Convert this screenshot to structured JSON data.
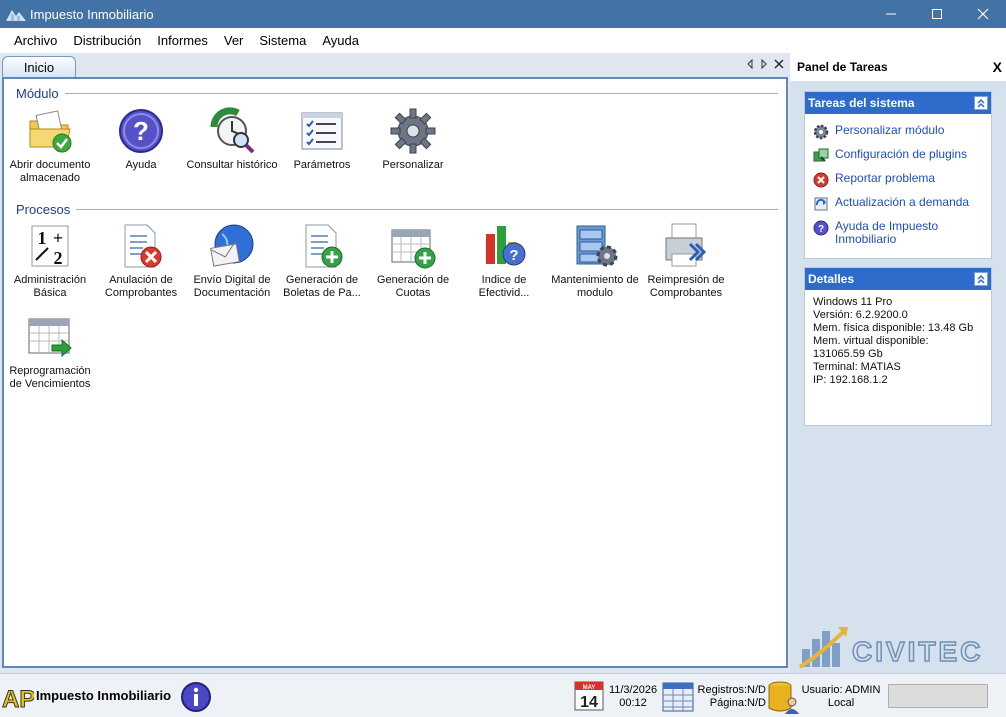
{
  "window": {
    "title": "Impuesto Inmobiliario"
  },
  "menu": [
    "Archivo",
    "Distribución",
    "Informes",
    "Ver",
    "Sistema",
    "Ayuda"
  ],
  "tab": {
    "label": "Inicio"
  },
  "modulo": {
    "header": "Módulo",
    "items": [
      {
        "label": "Abrir documento almacenado",
        "icon": "folder-check-icon"
      },
      {
        "label": "Ayuda",
        "icon": "help-icon"
      },
      {
        "label": "Consultar histórico",
        "icon": "history-clock-icon"
      },
      {
        "label": "Parámetros",
        "icon": "checklist-icon"
      },
      {
        "label": "Personalizar",
        "icon": "gear-icon"
      }
    ]
  },
  "procesos": {
    "header": "Procesos",
    "items": [
      {
        "label": "Administración Básica",
        "icon": "numbers-icon"
      },
      {
        "label": "Anulación de Comprobantes",
        "icon": "document-cancel-icon"
      },
      {
        "label": "Envío Digital de Documentación",
        "icon": "globe-mail-icon"
      },
      {
        "label": "Generación de Boletas de Pa...",
        "icon": "document-add-icon"
      },
      {
        "label": "Generación de Cuotas",
        "icon": "calendar-add-icon"
      },
      {
        "label": "Indice de Efectivid...",
        "icon": "chart-help-icon"
      },
      {
        "label": "Mantenimiento de modulo",
        "icon": "cabinet-gear-icon"
      },
      {
        "label": "Reimpresión de Comprobantes",
        "icon": "printer-icon"
      },
      {
        "label": "Reprogramación de Vencimientos",
        "icon": "calendar-arrow-icon"
      }
    ]
  },
  "taskpanel": {
    "title": "Panel de Tareas",
    "close": "X",
    "tareas": {
      "header": "Tareas del sistema",
      "items": [
        {
          "label": "Personalizar módulo",
          "icon": "gear-icon"
        },
        {
          "label": "Configuración de plugins",
          "icon": "plugin-icon"
        },
        {
          "label": "Reportar problema",
          "icon": "error-icon"
        },
        {
          "label": "Actualización a demanda",
          "icon": "update-icon"
        },
        {
          "label": "Ayuda de Impuesto Inmobiliario",
          "icon": "help-icon"
        }
      ]
    },
    "detalles": {
      "header": "Detalles",
      "lines": [
        "Windows 11 Pro",
        "Versión: 6.2.9200.0",
        "Mem. física disponible: 13.48 Gb",
        "Mem. virtual disponible:",
        "131065.59 Gb",
        "Terminal: MATIAS",
        "IP: 192.168.1.2"
      ]
    },
    "brand": "CIVITEC"
  },
  "status": {
    "app_name": "Impuesto Inmobiliario",
    "logo_text": "APi",
    "calendar_day": "14",
    "calendar_month": "MAY",
    "date": "11/3/2026",
    "time": "00:12",
    "registros": "Registros:N/D",
    "pagina": "Página:N/D",
    "usuario": "Usuario: ADMIN",
    "ubicacion": "Local"
  },
  "colors": {
    "titlebar": "#4272a6",
    "accent": "#2e6ccb",
    "link": "#1f4fb3",
    "section": "#1d3f8a"
  }
}
